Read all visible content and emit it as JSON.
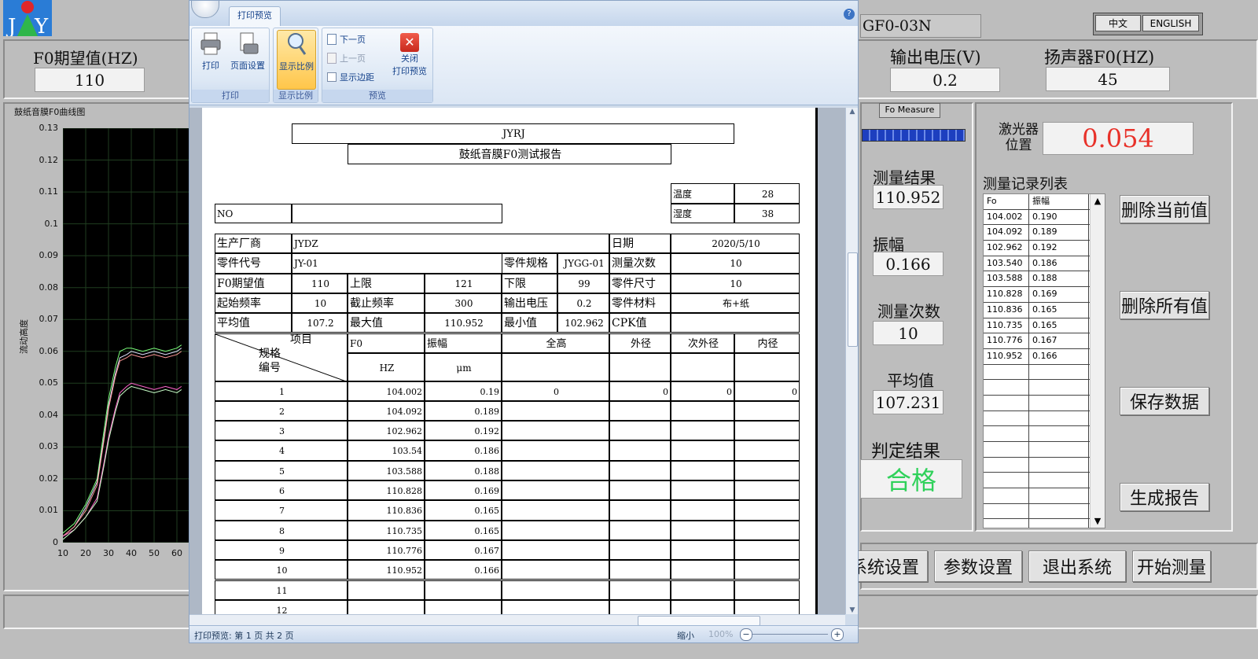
{
  "app": {
    "model": "GF0-03N",
    "lang_cn": "中文",
    "lang_en": "ENGLISH",
    "f0_expected_label": "F0期望值(HZ)",
    "f0_expected_value": "110",
    "output_voltage_label": "输出电压(V)",
    "output_voltage_value": "0.2",
    "speaker_f0_label": "扬声器F0(HZ)",
    "speaker_f0_value": "45",
    "chart_title": "鼓纸音膜F0曲线图",
    "chart_ylabel": "流动高度",
    "fo_measure": "Fo Measure",
    "laser_label_1": "激光器",
    "laser_label_2": "位置",
    "laser_value": "0.054",
    "result_label": "测量结果",
    "result_value": "110.952",
    "amp_label": "振幅",
    "amp_value": "0.166",
    "count_label": "测量次数",
    "count_value": "10",
    "avg_label": "平均值",
    "avg_value": "107.231",
    "judge_label": "判定结果",
    "judge_value": "合格",
    "records_title": "测量记录列表",
    "records_header": [
      "Fo",
      "振幅"
    ],
    "records": [
      [
        "104.002",
        "0.190"
      ],
      [
        "104.092",
        "0.189"
      ],
      [
        "102.962",
        "0.192"
      ],
      [
        "103.540",
        "0.186"
      ],
      [
        "103.588",
        "0.188"
      ],
      [
        "110.828",
        "0.169"
      ],
      [
        "110.836",
        "0.165"
      ],
      [
        "110.735",
        "0.165"
      ],
      [
        "110.776",
        "0.167"
      ],
      [
        "110.952",
        "0.166"
      ]
    ],
    "btn_delete_current": "删除当前值",
    "btn_delete_all": "删除所有值",
    "btn_save": "保存数据",
    "btn_report": "生成报告",
    "btn_system": "系统设置",
    "btn_params": "参数设置",
    "btn_exit": "退出系统",
    "btn_start": "开始测量"
  },
  "chart_data": {
    "type": "line",
    "ylabel": "流动高度",
    "xlim": [
      10,
      60
    ],
    "ylim": [
      0,
      0.13
    ],
    "x_ticks": [
      "10",
      "20",
      "30",
      "40",
      "50",
      "60"
    ],
    "y_ticks": [
      "0",
      "0.01",
      "0.02",
      "0.03",
      "0.04",
      "0.05",
      "0.06",
      "0.07",
      "0.08",
      "0.09",
      "0.1",
      "0.11",
      "0.12",
      "0.13"
    ],
    "series": [
      {
        "color": "#7cff7c",
        "x": [
          10,
          15,
          20,
          25,
          28,
          30,
          33,
          35,
          38,
          40,
          45,
          50,
          55,
          60,
          62
        ],
        "y": [
          0.003,
          0.006,
          0.012,
          0.02,
          0.035,
          0.045,
          0.055,
          0.06,
          0.061,
          0.061,
          0.06,
          0.061,
          0.06,
          0.061,
          0.062
        ]
      },
      {
        "color": "#e0e0ff",
        "x": [
          10,
          15,
          20,
          25,
          28,
          30,
          33,
          35,
          38,
          40,
          45,
          50,
          55,
          60,
          62
        ],
        "y": [
          0.002,
          0.005,
          0.011,
          0.019,
          0.033,
          0.043,
          0.053,
          0.058,
          0.059,
          0.06,
          0.059,
          0.06,
          0.059,
          0.06,
          0.061
        ]
      },
      {
        "color": "#ff9999",
        "x": [
          10,
          15,
          20,
          25,
          28,
          30,
          33,
          35,
          38,
          40,
          45,
          50,
          55,
          60,
          62
        ],
        "y": [
          0.002,
          0.005,
          0.01,
          0.018,
          0.032,
          0.042,
          0.052,
          0.057,
          0.058,
          0.059,
          0.058,
          0.059,
          0.058,
          0.059,
          0.06
        ]
      },
      {
        "color": "#ff66cc",
        "x": [
          10,
          15,
          20,
          25,
          28,
          30,
          33,
          35,
          38,
          40,
          45,
          50,
          55,
          60,
          62
        ],
        "y": [
          0.002,
          0.004,
          0.008,
          0.014,
          0.025,
          0.033,
          0.042,
          0.047,
          0.049,
          0.05,
          0.049,
          0.048,
          0.049,
          0.048,
          0.049
        ]
      },
      {
        "color": "#c8ffc8",
        "x": [
          10,
          15,
          20,
          25,
          28,
          30,
          33,
          35,
          38,
          40,
          45,
          50,
          55,
          60,
          62
        ],
        "y": [
          0.001,
          0.004,
          0.008,
          0.013,
          0.024,
          0.032,
          0.041,
          0.046,
          0.048,
          0.049,
          0.048,
          0.047,
          0.048,
          0.047,
          0.048
        ]
      }
    ]
  },
  "preview": {
    "tab": "打印预览",
    "print": "打印",
    "page_setup": "页面设置",
    "show_ratio": "显示比例",
    "next_page": "下一页",
    "prev_page": "上一页",
    "show_margin": "显示边距",
    "close_1": "关闭",
    "close_2": "打印预览",
    "group_print": "打印",
    "group_ratio": "显示比例",
    "group_preview": "预览",
    "status": "打印预览: 第 1 页  共 2 页",
    "zoom_label": "缩小",
    "zoom_value": "100%"
  },
  "report": {
    "company": "JYRJ",
    "title": "鼓纸音膜F0测试报告",
    "temp_label": "温度",
    "temp_value": "28",
    "humid_label": "湿度",
    "humid_value": "38",
    "no_label": "NO",
    "maker_label": "生产厂商",
    "maker_value": "JYDZ",
    "date_label": "日期",
    "date_value": "2020/5/10",
    "part_code_label": "零件代号",
    "part_code_value": "JY-01",
    "part_spec_label": "零件规格",
    "part_spec_value": "JYGG-01",
    "count_label": "测量次数",
    "count_value": "10",
    "f0_label": "F0期望值",
    "f0_value": "110",
    "upper_label": "上限",
    "upper_value": "121",
    "lower_label": "下限",
    "lower_value": "99",
    "size_label": "零件尺寸",
    "size_value": "10",
    "start_label": "起始频率",
    "start_value": "10",
    "stop_label": "截止频率",
    "stop_value": "300",
    "volt_label": "输出电压",
    "volt_value": "0.2",
    "material_label": "零件材料",
    "material_value": "布+纸",
    "avg_label": "平均值",
    "avg_value": "107.2",
    "max_label": "最大值",
    "max_value": "110.952",
    "min_label": "最小值",
    "min_value": "102.962",
    "cpk_label": "CPK值",
    "diag_item": "项目",
    "diag_spec": "规格",
    "diag_no": "编号",
    "h_f0": "F0",
    "h_amp": "振幅",
    "h_height": "全高",
    "h_outer": "外径",
    "h_sub_outer": "次外径",
    "h_inner": "内径",
    "u_f0": "HZ",
    "u_amp": "μm",
    "rows": [
      {
        "no": "1",
        "f0": "104.002",
        "amp": "0.19",
        "h": "0",
        "o": "0",
        "so": "0",
        "i": "0"
      },
      {
        "no": "2",
        "f0": "104.092",
        "amp": "0.189"
      },
      {
        "no": "3",
        "f0": "102.962",
        "amp": "0.192"
      },
      {
        "no": "4",
        "f0": "103.54",
        "amp": "0.186"
      },
      {
        "no": "5",
        "f0": "103.588",
        "amp": "0.188"
      },
      {
        "no": "6",
        "f0": "110.828",
        "amp": "0.169"
      },
      {
        "no": "7",
        "f0": "110.836",
        "amp": "0.165"
      },
      {
        "no": "8",
        "f0": "110.735",
        "amp": "0.165"
      },
      {
        "no": "9",
        "f0": "110.776",
        "amp": "0.167"
      },
      {
        "no": "10",
        "f0": "110.952",
        "amp": "0.166"
      },
      {
        "no": "11"
      },
      {
        "no": "12"
      }
    ]
  }
}
